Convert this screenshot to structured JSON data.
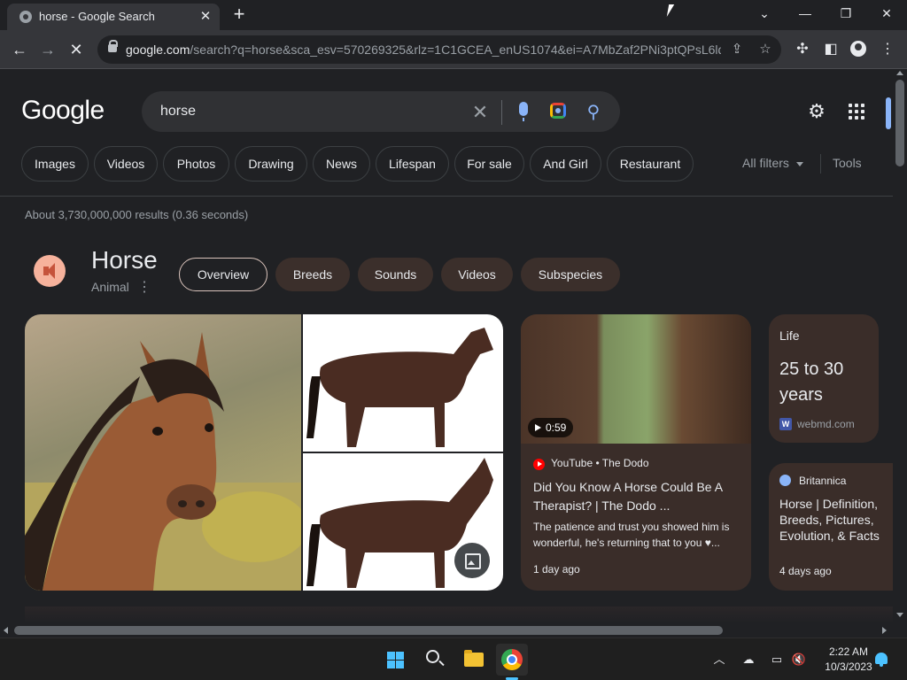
{
  "browser": {
    "tab_title": "horse - Google Search",
    "url_host": "google.com",
    "url_path": "/search?q=horse&sca_esv=570269325&rlz=1C1GCEA_enUS1074&ei=A7MbZaf2PNi3ptQPsL6lq..."
  },
  "google": {
    "logo_text": "Google",
    "search_query": "horse",
    "chips": [
      "Images",
      "Videos",
      "Photos",
      "Drawing",
      "News",
      "Lifespan",
      "For sale",
      "And Girl",
      "Restaurant"
    ],
    "all_filters_label": "All filters",
    "tools_label": "Tools",
    "result_stats": "About 3,730,000,000 results (0.36 seconds)"
  },
  "knowledge_panel": {
    "title": "Horse",
    "subtitle": "Animal",
    "tabs": [
      "Overview",
      "Breeds",
      "Sounds",
      "Videos",
      "Subspecies"
    ],
    "active_tab": "Overview"
  },
  "video_card": {
    "duration": "0:59",
    "source": "YouTube • The Dodo",
    "title": "Did You Know A Horse Could Be A Therapist? | The Dodo ...",
    "description": "The patience and trust you showed him is wonderful, he's returning that to you ♥...",
    "date": "1 day ago"
  },
  "facts": [
    {
      "label": "Life",
      "value": "25 to 30 years",
      "source": "webmd.com",
      "source_icon": "W"
    }
  ],
  "sidebar_snippets": [
    {
      "source": "Britannica",
      "title": "Horse | Definition, Breeds, Pictures, Evolution, & Facts",
      "date": "4 days ago"
    }
  ],
  "taskbar": {
    "time": "2:22 AM",
    "date": "10/3/2023"
  },
  "colors": {
    "page_bg": "#202124",
    "card_bg": "#3a2d29",
    "accent": "#8ab4f8",
    "taskbar_accent": "#4cc2ff"
  }
}
